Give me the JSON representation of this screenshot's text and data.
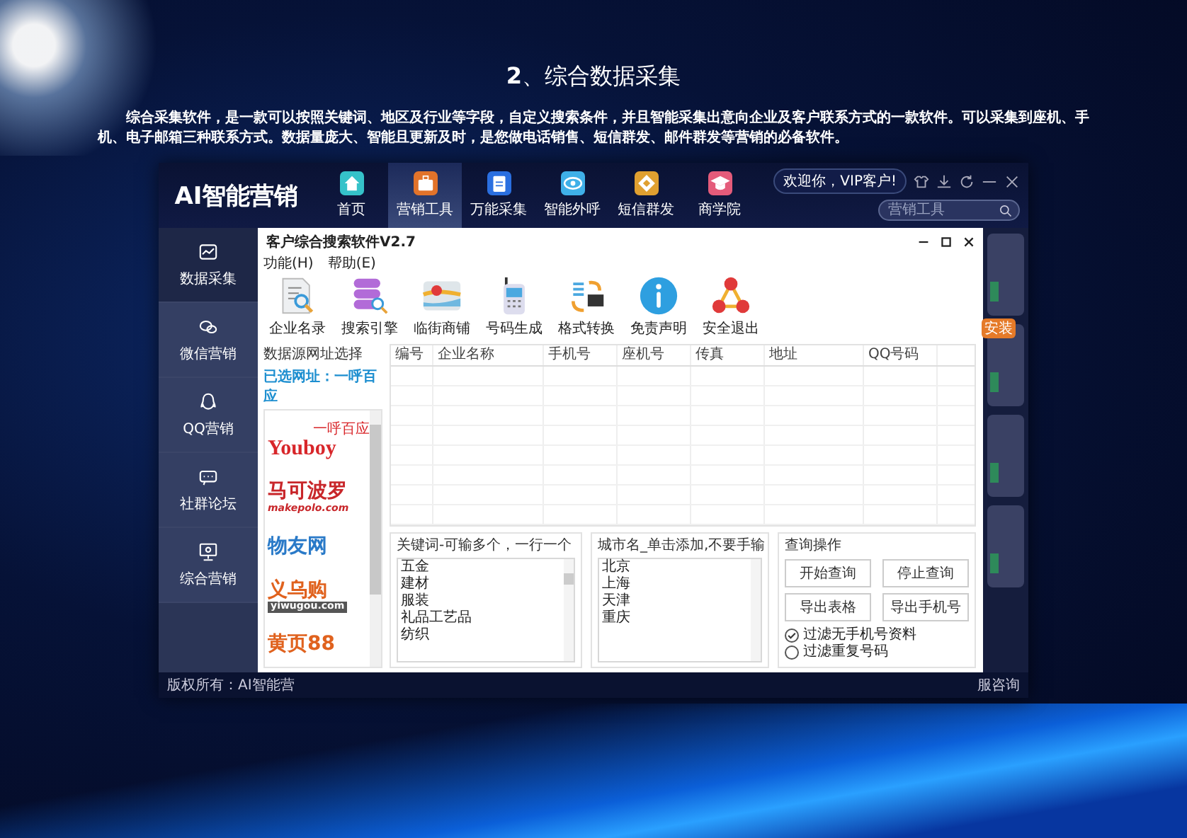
{
  "page": {
    "title": "**2**、综合数据采集",
    "intro": "综合采集软件，是一款可以按照关键词、地区及行业等字段，自定义搜索条件，并且智能采集出意向企业及客户联系方式的一款软件。可以采集到座机、手机、电子邮箱三种联系方式。数据量庞大、智能且更新及时，是您做电话销售、短信群发、邮件群发等营销的必备软件。"
  },
  "app": {
    "logo": "AI智能营销",
    "nav": [
      {
        "label": "首页",
        "kind": "home",
        "color": "#35c2c9",
        "selected": false
      },
      {
        "label": "营销工具",
        "kind": "briefcase",
        "color": "#e2732a",
        "selected": true
      },
      {
        "label": "万能采集",
        "kind": "clipboard",
        "color": "#2a6fe0",
        "selected": false
      },
      {
        "label": "智能外呼",
        "kind": "eye",
        "color": "#3fb0e8",
        "selected": false
      },
      {
        "label": "短信群发",
        "kind": "diamond",
        "color": "#e0a030",
        "selected": false
      },
      {
        "label": "商学院",
        "kind": "cap",
        "color": "#e45b7a",
        "selected": false
      }
    ],
    "welcome": "欢迎你，VIP客户!",
    "search": {
      "placeholder": "营销工具"
    },
    "sidebar": [
      {
        "label": "数据采集",
        "kind": "chart",
        "selected": true
      },
      {
        "label": "微信营销",
        "kind": "wechat",
        "selected": false
      },
      {
        "label": "QQ营销",
        "kind": "qq",
        "selected": false
      },
      {
        "label": "社群论坛",
        "kind": "forum",
        "selected": false
      },
      {
        "label": "综合营销",
        "kind": "monitor",
        "selected": false
      }
    ],
    "footer_left": "版权所有：AI智能营",
    "footer_right": "服咨询",
    "badge": "安装"
  },
  "dialog": {
    "title": "客户综合搜索软件V2.7",
    "menu": [
      "功能(H)",
      "帮助(E)"
    ],
    "tools": [
      {
        "label": "企业名录",
        "kind": "document"
      },
      {
        "label": "搜索引擎",
        "kind": "database"
      },
      {
        "label": "临街商铺",
        "kind": "map"
      },
      {
        "label": "号码生成",
        "kind": "phone"
      },
      {
        "label": "格式转换",
        "kind": "convert"
      },
      {
        "label": "免责声明",
        "kind": "info"
      },
      {
        "label": "安全退出",
        "kind": "exit"
      }
    ],
    "sources": {
      "title": "数据源网址选择",
      "selected_label": "已选网址：一呼百应",
      "items": [
        {
          "kind": "youboy",
          "name": "Youboy",
          "tag": "一呼百应"
        },
        {
          "kind": "makepolo",
          "name": "马可波罗",
          "tag": "makepolo.com"
        },
        {
          "kind": "wuyou",
          "name": "物友网"
        },
        {
          "kind": "yiwugou",
          "name": "义乌购",
          "tag": "yiwugou.com"
        },
        {
          "kind": "huangye",
          "name": "黄页88"
        }
      ]
    },
    "table": {
      "columns": [
        "编号",
        "企业名称",
        "手机号",
        "座机号",
        "传真",
        "地址",
        "QQ号码"
      ]
    },
    "keywords": {
      "title": "关键词-可输多个，一行一个",
      "items": [
        "五金",
        "建材",
        "服装",
        "礼品工艺品",
        "纺织"
      ]
    },
    "cities": {
      "title": "城市名_单击添加,不要手输",
      "items": [
        "北京",
        "上海",
        "天津",
        "重庆"
      ]
    },
    "query": {
      "title": "查询操作",
      "buttons": [
        "开始查询",
        "停止查询",
        "导出表格",
        "导出手机号"
      ],
      "options": [
        {
          "label": "过滤无手机号资料",
          "checked": true
        },
        {
          "label": "过滤重复号码",
          "checked": false
        }
      ]
    }
  }
}
